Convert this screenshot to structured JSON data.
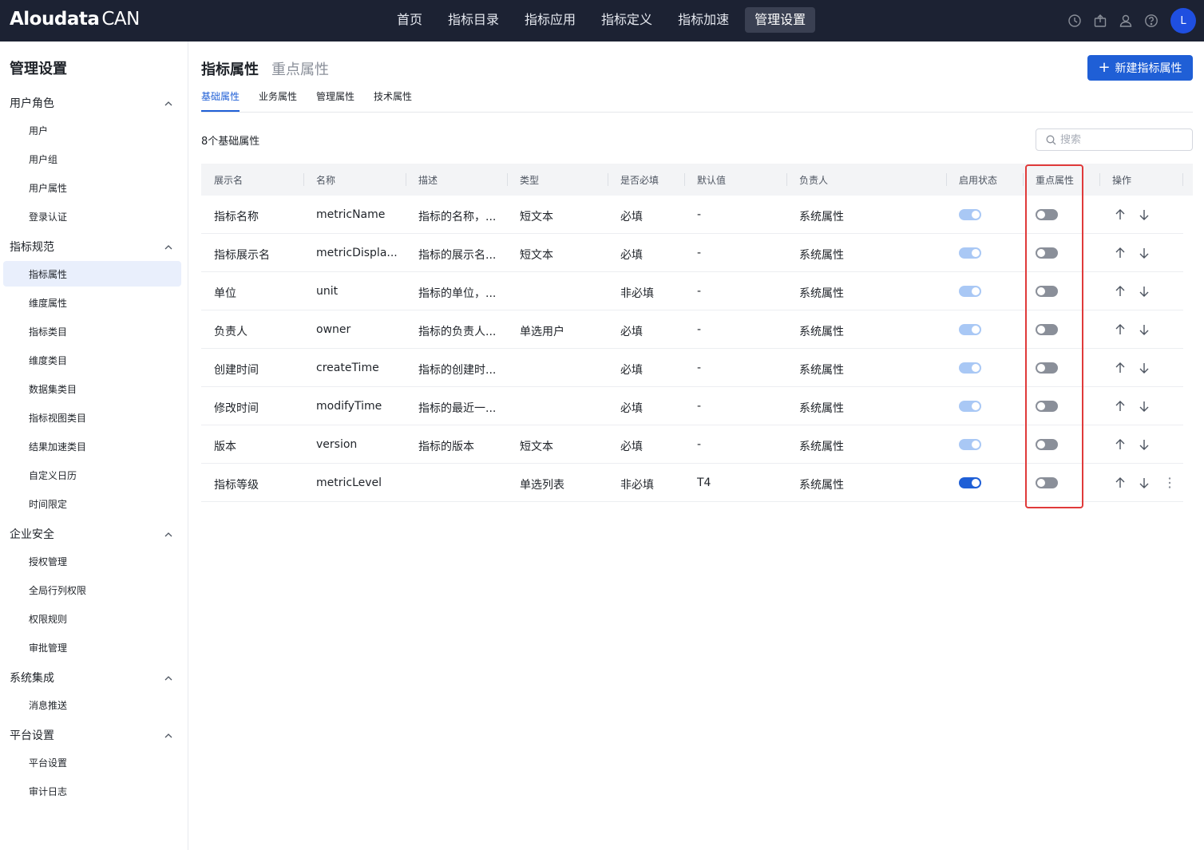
{
  "app": {
    "brand": "Aloudata",
    "product": "CAN"
  },
  "nav": {
    "items": [
      "首页",
      "指标目录",
      "指标应用",
      "指标定义",
      "指标加速",
      "管理设置"
    ],
    "active_index": 5
  },
  "user": {
    "initial": "L"
  },
  "sidebar": {
    "title": "管理设置",
    "groups": [
      {
        "label": "用户角色",
        "items": [
          "用户",
          "用户组",
          "用户属性",
          "登录认证"
        ]
      },
      {
        "label": "指标规范",
        "items": [
          "指标属性",
          "维度属性",
          "指标类目",
          "维度类目",
          "数据集类目",
          "指标视图类目",
          "结果加速类目",
          "自定义日历",
          "时间限定"
        ]
      },
      {
        "label": "企业安全",
        "items": [
          "授权管理",
          "全局行列权限",
          "权限规则",
          "审批管理"
        ]
      },
      {
        "label": "系统集成",
        "items": [
          "消息推送"
        ]
      },
      {
        "label": "平台设置",
        "items": [
          "平台设置",
          "审计日志"
        ]
      }
    ],
    "active_item": "指标属性"
  },
  "main": {
    "title": "指标属性",
    "subtitle": "重点属性",
    "new_button": "新建指标属性",
    "tabs": [
      "基础属性",
      "业务属性",
      "管理属性",
      "技术属性"
    ],
    "active_tab": 0,
    "count_label": "8个基础属性",
    "search_placeholder": "搜索"
  },
  "table": {
    "headers": [
      "展示名",
      "名称",
      "描述",
      "类型",
      "是否必填",
      "默认值",
      "负责人",
      "启用状态",
      "重点属性",
      "操作"
    ],
    "rows": [
      {
        "display": "指标名称",
        "name": "metricName",
        "desc": "指标的名称，...",
        "type": "短文本",
        "required": "必填",
        "default": "-",
        "owner": "系统属性",
        "enabled": "locked-on",
        "key_attr": false
      },
      {
        "display": "指标展示名",
        "name": "metricDispla...",
        "desc": "指标的展示名...",
        "type": "短文本",
        "required": "必填",
        "default": "-",
        "owner": "系统属性",
        "enabled": "locked-on",
        "key_attr": false
      },
      {
        "display": "单位",
        "name": "unit",
        "desc": "指标的单位，...",
        "type": "",
        "required": "非必填",
        "default": "-",
        "owner": "系统属性",
        "enabled": "locked-on",
        "key_attr": false
      },
      {
        "display": "负责人",
        "name": "owner",
        "desc": "指标的负责人...",
        "type": "单选用户",
        "required": "必填",
        "default": "-",
        "owner": "系统属性",
        "enabled": "locked-on",
        "key_attr": false
      },
      {
        "display": "创建时间",
        "name": "createTime",
        "desc": "指标的创建时...",
        "type": "",
        "required": "必填",
        "default": "-",
        "owner": "系统属性",
        "enabled": "locked-on",
        "key_attr": false
      },
      {
        "display": "修改时间",
        "name": "modifyTime",
        "desc": "指标的最近一...",
        "type": "",
        "required": "必填",
        "default": "-",
        "owner": "系统属性",
        "enabled": "locked-on",
        "key_attr": false
      },
      {
        "display": "版本",
        "name": "version",
        "desc": "指标的版本",
        "type": "短文本",
        "required": "必填",
        "default": "-",
        "owner": "系统属性",
        "enabled": "locked-on",
        "key_attr": false
      },
      {
        "display": "指标等级",
        "name": "metricLevel",
        "desc": "",
        "type": "单选列表",
        "required": "非必填",
        "default": "T4",
        "owner": "系统属性",
        "enabled": "on",
        "key_attr": false
      }
    ]
  },
  "colors": {
    "topbar": "#1c2233",
    "accent": "#1f5fd6",
    "toggle_locked": "#a9c8f5",
    "toggle_off": "#8a8f99",
    "highlight": "#e03a3a"
  }
}
